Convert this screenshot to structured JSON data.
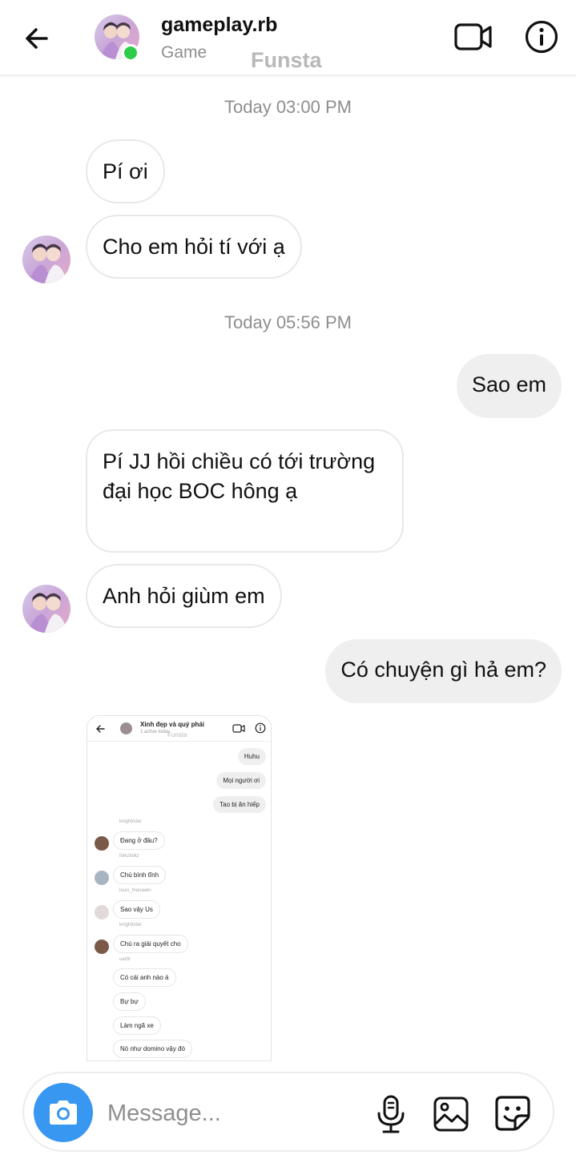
{
  "header": {
    "name": "gameplay.rb",
    "subtitle": "Game",
    "watermark": "Funsta"
  },
  "thread": {
    "timestamps": [
      "Today 03:00 PM",
      "Today 05:56 PM"
    ],
    "messages": [
      {
        "dir": "in",
        "text": "Pí ơi"
      },
      {
        "dir": "in",
        "text": "Cho em hỏi tí với ạ"
      },
      {
        "dir": "out",
        "text": "Sao em"
      },
      {
        "dir": "in",
        "text": "Pí JJ hồi chiều có tới trường đại học BOC hông ạ"
      },
      {
        "dir": "in",
        "text": "Anh hỏi giùm em"
      },
      {
        "dir": "out",
        "text": "Có chuyện gì hả em?"
      }
    ],
    "shared_image": {
      "title": "Xinh đẹp và quý phái",
      "subtitle": "1 active today",
      "watermark": "Funsta",
      "messages": [
        {
          "dir": "out",
          "text": "Huhu"
        },
        {
          "dir": "out",
          "text": "Mọi người ơi"
        },
        {
          "dir": "out",
          "text": "Tao bị ăn hiếp"
        },
        {
          "user": "knightrider",
          "text": "Đang ở đâu?"
        },
        {
          "user": "folkzfolkz",
          "text": "Chú bình tĩnh"
        },
        {
          "user": "louis_thanawin",
          "text": "Sao vậy Us"
        },
        {
          "user": "knightrider",
          "text": "Chú ra giải quyết cho"
        },
        {
          "user": "uarttr",
          "text": "Có cái anh nào á"
        },
        {
          "user": "",
          "text": "Bự bự"
        },
        {
          "user": "",
          "text": "Làm ngã xe"
        },
        {
          "user": "",
          "text": "Nó như domino vậy đó"
        }
      ]
    }
  },
  "composer": {
    "placeholder": "Message..."
  },
  "colors": {
    "accent": "#3897f0",
    "online": "#2ecc4a",
    "bubble_out": "#efefef",
    "bubble_in_border": "#e8e8e8",
    "muted_text": "#8e8e8e"
  },
  "icons": [
    "back-arrow-icon",
    "video-call-icon",
    "info-icon",
    "camera-icon",
    "microphone-icon",
    "gallery-icon",
    "sticker-icon"
  ]
}
